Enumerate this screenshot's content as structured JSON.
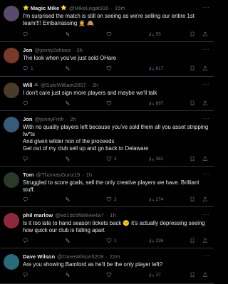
{
  "colors": {
    "background": "#000000",
    "text": "#e7e9ea",
    "muted": "#71767b",
    "divider": "#2f3336"
  },
  "tweets": [
    {
      "name": "Magic Mike",
      "name_emoji_before": "⭐",
      "name_emoji_after": "⭐",
      "handle": "@MikeLegat316",
      "time": "15m",
      "text": "I'm surprised the match is still on seeing as we're selling our entire 1st team!!!! Embarrassing 🤦 🙈",
      "replies": "",
      "retweets": "",
      "likes": "",
      "views": "55",
      "avatar_color": "#5a4a6a"
    },
    {
      "name": "Jon",
      "handle": "@jonny2shoez",
      "time": "2h",
      "text": "The look when you've just sold OHare",
      "replies": "1",
      "retweets": "",
      "likes": "",
      "views": "617",
      "avatar_color": "#7a3a2a"
    },
    {
      "name": "Will",
      "name_emoji_after": "⚔",
      "handle": "@SufcWilliam2007",
      "time": "2h",
      "text": "I don't care just sign  more players and maybe we'll talk",
      "replies": "",
      "retweets": "",
      "likes": "",
      "views": "697",
      "avatar_color": "#4a3a2a"
    },
    {
      "name": "Jon",
      "handle": "@jonnyFrith",
      "time": "2h",
      "text": "With no quality players left because you've sold them all you asset stripping tw*ts\nAnd given wilder non of the proceeds\nGet out of my club sell up and go back to Delaware",
      "replies": "",
      "retweets": "",
      "likes": "3",
      "views": "381",
      "avatar_color": "#3a5a7a"
    },
    {
      "name": "Tom",
      "handle": "@ThomasGunz19",
      "time": "1h",
      "text": "Struggled to score goals, sell the only creative players we have. Brilliant stuff.",
      "replies": "",
      "retweets": "",
      "likes": "2",
      "views": "274",
      "avatar_color": "#2a3a2a"
    },
    {
      "name": "phil marlow",
      "handle": "@ed1dc5f8864e4a7",
      "time": "1h",
      "text": "Is it too late to hand season tickets back 😕 it's actually depressing seeing how quick our club is falling apart",
      "replies": "",
      "retweets": "",
      "likes": "1",
      "views": "236",
      "avatar_color": "#8a2a3a"
    },
    {
      "name": "Dave Wilson",
      "handle": "@DaveWilson5209",
      "time": "22m",
      "text": "Are you showing Bamford as he'll be the only player left?",
      "replies": "",
      "retweets": "",
      "likes": "",
      "views": "37",
      "avatar_color": "#2a6a7a"
    }
  ]
}
